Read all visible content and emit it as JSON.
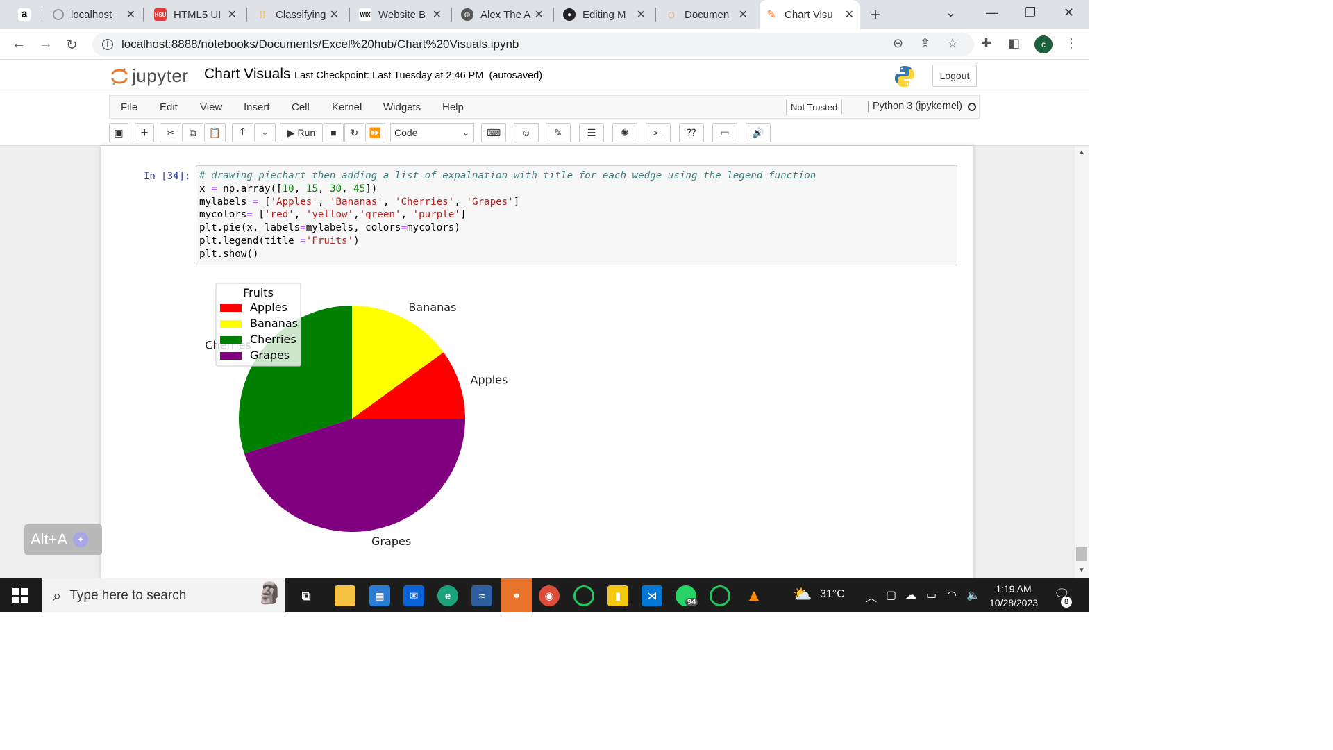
{
  "browser": {
    "tabs": [
      {
        "label": "",
        "icon": "amazon-icon"
      },
      {
        "label": "localhost",
        "icon": "loading-icon"
      },
      {
        "label": "HTML5 UI",
        "icon": "hsu-icon"
      },
      {
        "label": "Classifying",
        "icon": "dots-icon"
      },
      {
        "label": "Website B",
        "icon": "wix-icon"
      },
      {
        "label": "Alex The A",
        "icon": "globe-icon"
      },
      {
        "label": "Editing M",
        "icon": "github-icon"
      },
      {
        "label": "Documen",
        "icon": "jupyter-icon"
      },
      {
        "label": "Chart Visu",
        "icon": "notebook-icon",
        "active": true
      }
    ],
    "url": "localhost:8888/notebooks/Documents/Excel%20hub/Chart%20Visuals.ipynb",
    "profile_initial": "c"
  },
  "jupyter": {
    "logo_text": "jupyter",
    "notebook_title": "Chart Visuals",
    "checkpoint": "Last Checkpoint: Last Tuesday at 2:46 PM",
    "autosave": "(autosaved)",
    "logout_label": "Logout",
    "menu": [
      "File",
      "Edit",
      "View",
      "Insert",
      "Cell",
      "Kernel",
      "Widgets",
      "Help"
    ],
    "trust_label": "Not Trusted",
    "kernel_label": "Python 3 (ipykernel)",
    "run_label": "Run",
    "cell_type": "Code"
  },
  "cell": {
    "prompt": "In [34]:",
    "comment": "# drawing piechart then adding a list of expalnation with title for each wedge using the legend function",
    "line_x_pre": "x ",
    "line_x_eq": "=",
    "line_x_mid": " np.array([",
    "nums": [
      "10",
      "15",
      "30",
      "45"
    ],
    "labels_var": "mylabels ",
    "labels_strs": [
      "'Apples'",
      "'Bananas'",
      "'Cherries'",
      "'Grapes'"
    ],
    "colors_var": "mycolors",
    "colors_strs": [
      "'red'",
      "'yellow'",
      "'green'",
      "'purple'"
    ],
    "pie_pre": "plt.pie(x, labels",
    "pie_mid": "mylabels, colors",
    "pie_post": "mycolors)",
    "legend_pre": "plt.legend(title ",
    "legend_str": "'Fruits'",
    "show": "plt.show()"
  },
  "chart_data": {
    "type": "pie",
    "categories": [
      "Apples",
      "Bananas",
      "Cherries",
      "Grapes"
    ],
    "values": [
      10,
      15,
      30,
      45
    ],
    "colors": [
      "#ff0000",
      "#ffff00",
      "#008000",
      "#800080"
    ],
    "legend_title": "Fruits",
    "legend_placement": "upper-left",
    "start_angle_deg": 0,
    "direction": "counterclockwise"
  },
  "overlay": {
    "alt_label": "Alt+A"
  },
  "taskbar": {
    "search_placeholder": "Type here to search",
    "weather": "31°C",
    "time": "1:19 AM",
    "date": "10/28/2023",
    "notification_count": "8",
    "whatsapp_badge": "94"
  }
}
